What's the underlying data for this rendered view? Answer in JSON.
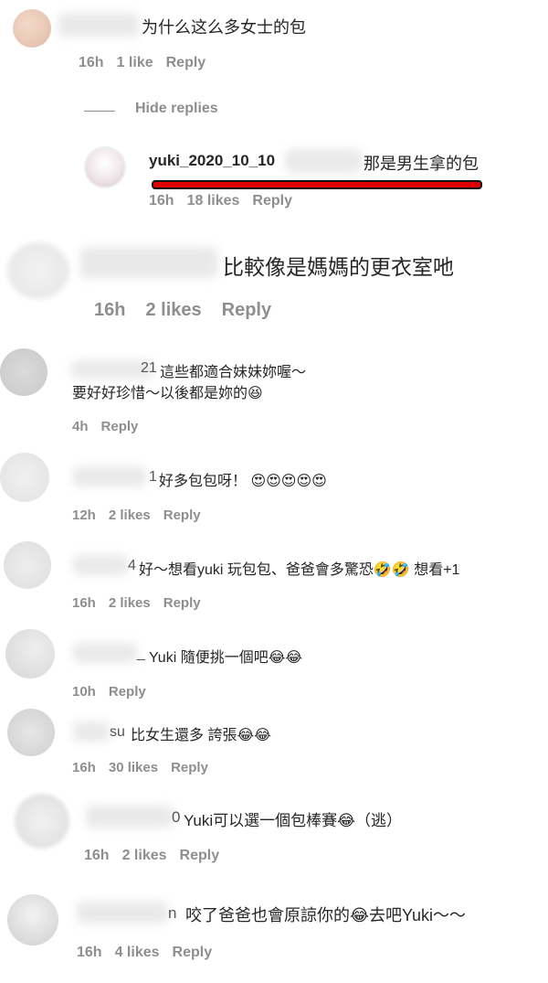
{
  "comments": [
    {
      "text": "为什么这么多女士的包",
      "meta": {
        "time": "16h",
        "likes": "1 like",
        "reply": "Reply"
      }
    },
    {
      "hide_replies": "Hide replies"
    },
    {
      "user": "yuki_2020_10_10",
      "text": "那是男生拿的包",
      "meta": {
        "time": "16h",
        "likes": "18 likes",
        "reply": "Reply"
      }
    },
    {
      "text": "比較像是媽媽的更衣室吔",
      "meta": {
        "time": "16h",
        "likes": "2 likes",
        "reply": "Reply"
      }
    },
    {
      "prefix": "21",
      "line1": "這些都適合妹妹妳喔～",
      "line2": "要好好珍惜～以後都是妳的😆",
      "meta": {
        "time": "4h",
        "reply": "Reply"
      }
    },
    {
      "prefix": "1",
      "text": "好多包包呀！ 😍😍😍😍😍",
      "meta": {
        "time": "12h",
        "likes": "2 likes",
        "reply": "Reply"
      }
    },
    {
      "prefix": "4",
      "text": "好～想看yuki 玩包包、爸爸會多驚恐🤣🤣 想看+1",
      "meta": {
        "time": "16h",
        "likes": "2 likes",
        "reply": "Reply"
      }
    },
    {
      "prefix": "_",
      "text": "Yuki 隨便挑一個吧😂😂",
      "meta": {
        "time": "10h",
        "reply": "Reply"
      }
    },
    {
      "prefix": "su",
      "text": "比女生還多 誇張😂😂",
      "meta": {
        "time": "16h",
        "likes": "30 likes",
        "reply": "Reply"
      }
    },
    {
      "prefix": "0",
      "text": "Yuki可以選一個包棒賽😂（逃）",
      "meta": {
        "time": "16h",
        "likes": "2 likes",
        "reply": "Reply"
      }
    },
    {
      "prefix": "n",
      "text": "咬了爸爸也會原諒你的😂去吧Yuki～～",
      "meta": {
        "time": "16h",
        "likes": "4 likes",
        "reply": "Reply"
      }
    }
  ]
}
